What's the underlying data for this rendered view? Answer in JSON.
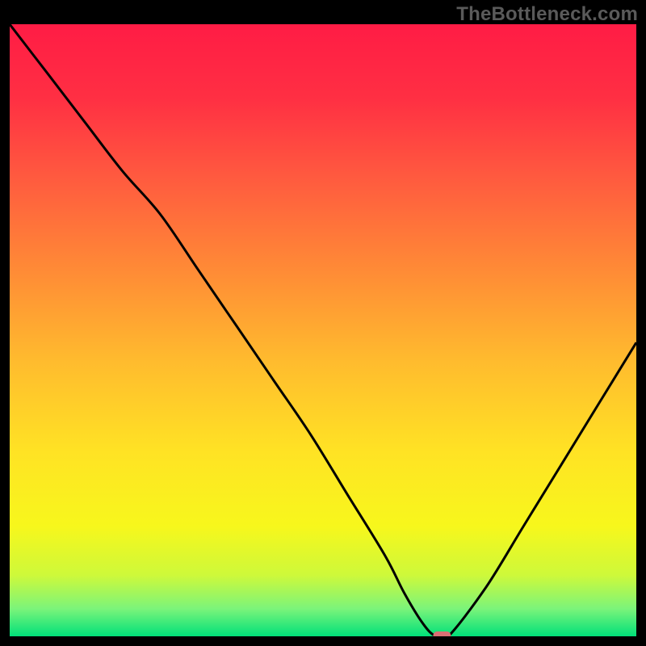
{
  "watermark": {
    "text": "TheBottleneck.com"
  },
  "colors": {
    "gradient_stops": [
      {
        "offset": 0.0,
        "color": "#ff1c45"
      },
      {
        "offset": 0.12,
        "color": "#ff2f43"
      },
      {
        "offset": 0.25,
        "color": "#ff5a3f"
      },
      {
        "offset": 0.4,
        "color": "#ff8a36"
      },
      {
        "offset": 0.55,
        "color": "#ffbb2e"
      },
      {
        "offset": 0.7,
        "color": "#ffe324"
      },
      {
        "offset": 0.82,
        "color": "#f7f71c"
      },
      {
        "offset": 0.9,
        "color": "#cef93a"
      },
      {
        "offset": 0.955,
        "color": "#7bf47a"
      },
      {
        "offset": 1.0,
        "color": "#00e07a"
      }
    ],
    "curve": "#000000",
    "marker_fill": "#d96f74",
    "marker_stroke": "#b94b52",
    "frame": "#000000"
  },
  "chart_data": {
    "type": "line",
    "title": "",
    "xlabel": "",
    "ylabel": "",
    "xlim": [
      0,
      100
    ],
    "ylim": [
      0,
      100
    ],
    "grid": false,
    "legend": false,
    "series": [
      {
        "name": "bottleneck-curve",
        "x": [
          0,
          6,
          12,
          18,
          24,
          30,
          36,
          42,
          48,
          54,
          60,
          63,
          66,
          68,
          70,
          76,
          82,
          88,
          94,
          100
        ],
        "y": [
          100,
          92,
          84,
          76,
          69,
          60,
          51,
          42,
          33,
          23,
          13,
          7,
          2,
          0,
          0,
          8,
          18,
          28,
          38,
          48
        ]
      }
    ],
    "marker": {
      "x": 69,
      "y": 0
    }
  }
}
